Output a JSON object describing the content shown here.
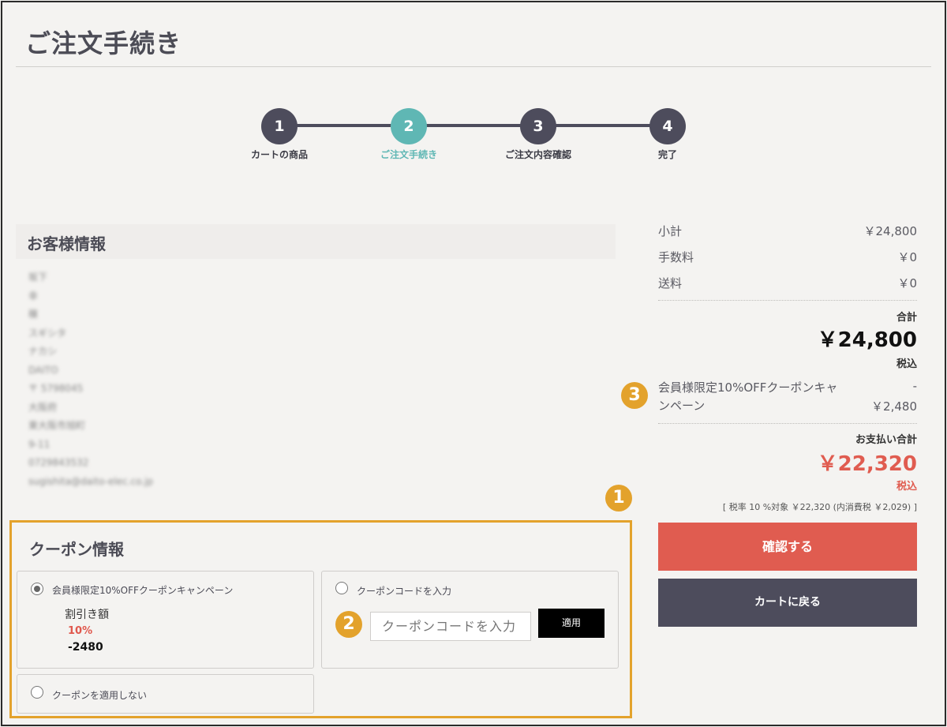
{
  "page": {
    "title": "ご注文手続き"
  },
  "steps": [
    {
      "number": "1",
      "label": "カートの商品"
    },
    {
      "number": "2",
      "label": "ご注文手続き"
    },
    {
      "number": "3",
      "label": "ご注文内容確認"
    },
    {
      "number": "4",
      "label": "完了"
    }
  ],
  "customer": {
    "title": "お客様情報",
    "lines": [
      "坂下",
      "幸",
      "穣",
      "スギシタ",
      "ナカシ",
      "DAITO",
      "〒 5798045",
      "大阪府",
      "東大阪市旭町",
      "9-11",
      "0729843532",
      "sugishita@daito-elec.co.jp"
    ]
  },
  "markers": {
    "m1": "1",
    "m2": "2",
    "m3": "3"
  },
  "coupon": {
    "title": "クーポン情報",
    "option_campaign": "会員様限定10%OFFクーポンキャンペーン",
    "discount_label": "割引き額",
    "discount_rate": "10%",
    "discount_amount": "-2480",
    "option_code": "クーポンコードを入力",
    "code_placeholder": "クーポンコードを入力",
    "apply_label": "適用",
    "option_none": "クーポンを適用しない"
  },
  "summary": {
    "subtotal_label": "小計",
    "subtotal_value": "￥24,800",
    "fee_label": "手数料",
    "fee_value": "￥0",
    "shipping_label": "送料",
    "shipping_value": "￥0",
    "total_label": "合計",
    "total_value": "￥24,800",
    "tax_incl": "税込",
    "coupon_line1": "会員様限定10%OFFクーポンキャ",
    "coupon_line2": "ンペーン",
    "coupon_dash": "-",
    "coupon_value": "￥2,480",
    "payment_label": "お支払い合計",
    "payment_value": "￥22,320",
    "payment_tax_incl": "税込",
    "tax_note": "[ 税率 10 %対象 ￥22,320 (内消費税 ￥2,029) ]"
  },
  "buttons": {
    "confirm": "確認する",
    "back": "カートに戻る"
  },
  "colors": {
    "accent_teal": "#5fb7b4",
    "step_dark": "#4d4c5c",
    "price_red": "#e05c50",
    "marker_orange": "#e3a22c"
  }
}
